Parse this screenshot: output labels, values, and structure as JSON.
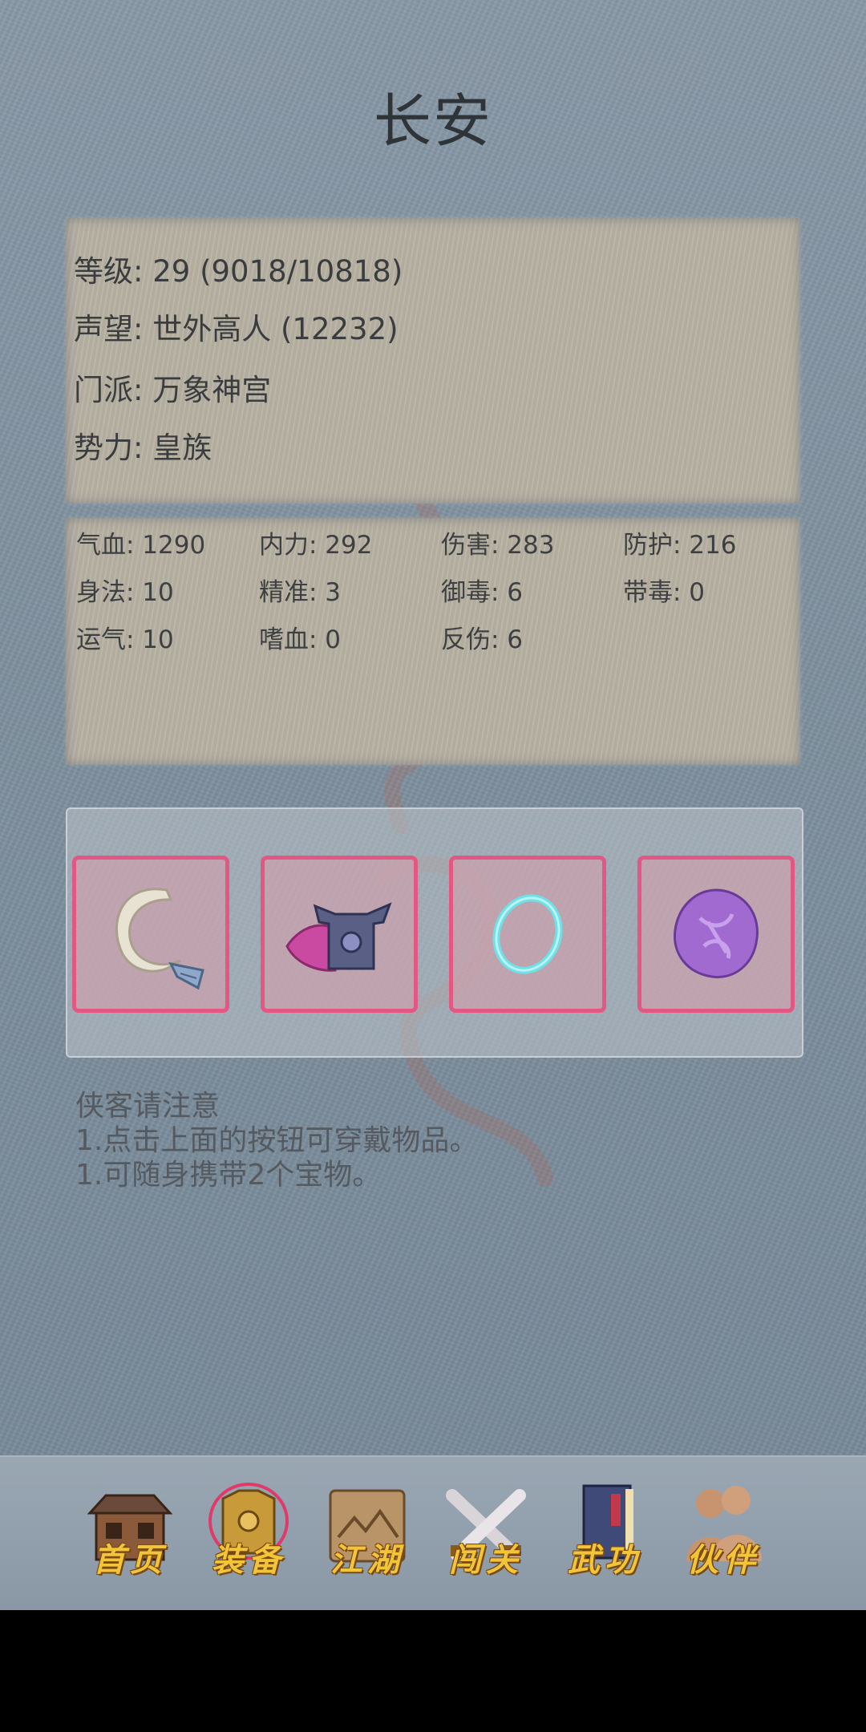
{
  "location_title": "长安",
  "info": {
    "level": "等级: 29 (9018/10818)",
    "reputation": "声望: 世外高人 (12232)",
    "sect": "门派: 万象神宫",
    "faction": "势力: 皇族"
  },
  "stats": [
    "气血: 1290",
    "内力: 292",
    "伤害: 283",
    "防护: 216",
    "身法: 10",
    "精准: 3",
    "御毒: 6",
    "带毒: 0",
    "运气: 10",
    "嗜血: 0",
    "反伤: 6"
  ],
  "equipment_slots": [
    {
      "icon": "hook-blade-icon"
    },
    {
      "icon": "armor-icon"
    },
    {
      "icon": "jade-ring-icon"
    },
    {
      "icon": "purple-amulet-icon"
    }
  ],
  "notes": {
    "heading": "侠客请注意",
    "line1": "1.点击上面的按钮可穿戴物品。",
    "line2": "1.可随身携带2个宝物。"
  },
  "nav": [
    {
      "label": "首页",
      "icon": "house-icon"
    },
    {
      "label": "装备",
      "icon": "armor-icon"
    },
    {
      "label": "江湖",
      "icon": "scroll-map-icon"
    },
    {
      "label": "闯关",
      "icon": "crossed-swords-icon"
    },
    {
      "label": "武功",
      "icon": "book-icon"
    },
    {
      "label": "伙伴",
      "icon": "companions-icon"
    }
  ],
  "colors": {
    "slot_border": "#e25882",
    "nav_label": "#f2c43a"
  }
}
